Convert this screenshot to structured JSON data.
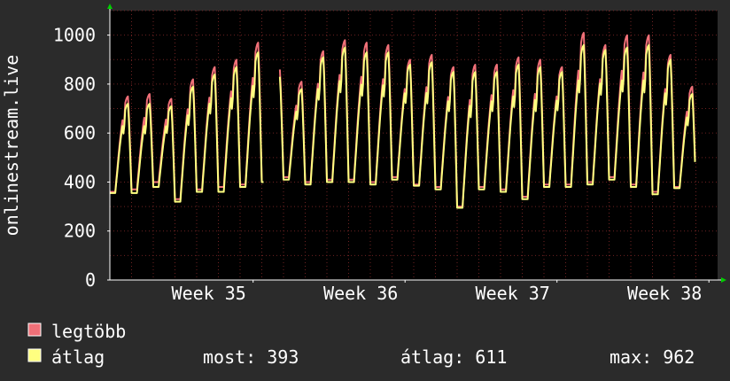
{
  "chart_data": {
    "type": "line",
    "ylabel": "onlinestream.live",
    "ylim": [
      0,
      1100
    ],
    "y_ticks": [
      0,
      200,
      400,
      600,
      800,
      1000
    ],
    "x_range_days": [
      0,
      28
    ],
    "x_ticks": [
      {
        "label": "Week 35",
        "day": 6.6
      },
      {
        "label": "Week 36",
        "day": 13.6
      },
      {
        "label": "Week 37",
        "day": 20.6
      },
      {
        "label": "Week 38",
        "day": 27.6
      }
    ],
    "grid": true,
    "series": [
      {
        "name": "legtöbb",
        "color": "#f07078",
        "daily_peaks": [
          750,
          760,
          740,
          820,
          870,
          900,
          970,
          860,
          810,
          935,
          980,
          970,
          960,
          900,
          920,
          870,
          880,
          880,
          910,
          900,
          870,
          1010,
          960,
          1000,
          1000,
          920,
          790
        ],
        "daily_troughs": [
          360,
          370,
          400,
          330,
          370,
          380,
          390,
          400,
          420,
          400,
          410,
          410,
          400,
          420,
          390,
          380,
          300,
          380,
          370,
          340,
          390,
          390,
          400,
          420,
          390,
          360,
          380
        ]
      },
      {
        "name": "átlag",
        "color": "#ffff80",
        "daily_peaks": [
          720,
          720,
          710,
          790,
          840,
          870,
          930,
          830,
          780,
          910,
          950,
          930,
          930,
          880,
          890,
          850,
          850,
          850,
          880,
          870,
          850,
          960,
          940,
          950,
          960,
          900,
          760
        ],
        "daily_troughs": [
          355,
          355,
          380,
          320,
          360,
          360,
          380,
          400,
          410,
          390,
          400,
          400,
          390,
          410,
          385,
          370,
          295,
          370,
          360,
          330,
          380,
          380,
          390,
          410,
          380,
          350,
          375
        ]
      }
    ],
    "gap_day": [
      7.1,
      7.8
    ],
    "legend": {
      "placement": "bottom-left",
      "stats": {
        "most": "most: 393",
        "atlag": "átlag: 611",
        "max": "max: 962"
      }
    },
    "colors": {
      "background": "#2b2b2b",
      "plot_background": "#000000",
      "grid": "#6e2222",
      "axis": "#ffffff",
      "arrow": "#00cc00"
    }
  }
}
